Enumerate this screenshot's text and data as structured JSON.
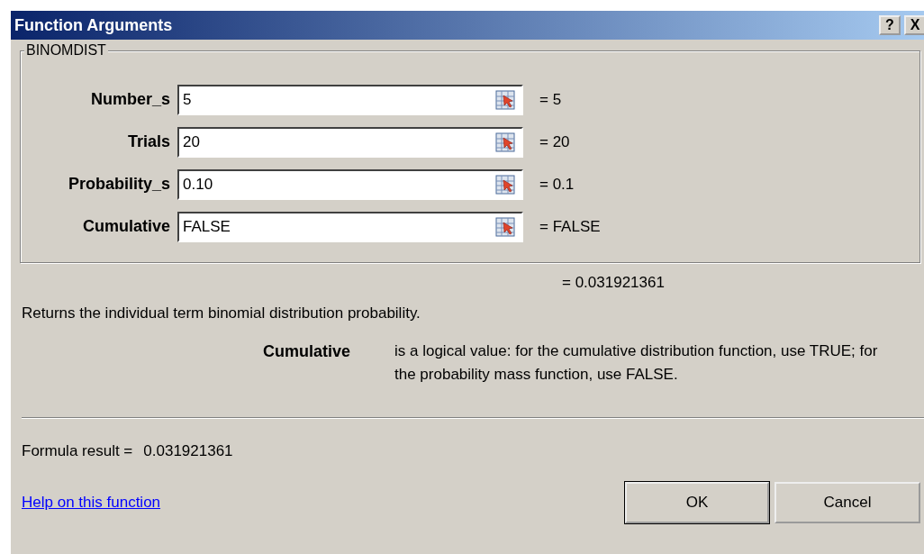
{
  "window": {
    "title": "Function Arguments",
    "title_buttons": [
      {
        "kind": "help",
        "label": "?"
      },
      {
        "kind": "close",
        "label": "X"
      }
    ]
  },
  "group": {
    "title": "BINOMDIST",
    "arguments": [
      {
        "label": "Number_s",
        "value": "5",
        "result": "= 5"
      },
      {
        "label": "Trials",
        "value": "20",
        "result": "= 20"
      },
      {
        "label": "Probability_s",
        "value": "0.10",
        "result": "= 0.1"
      },
      {
        "label": "Cumulative",
        "value": "FALSE",
        "result": "= FALSE"
      }
    ]
  },
  "result": "= 0.031921361",
  "description": "Returns the individual term binomial distribution probability.",
  "argument_help": {
    "name": "Cumulative",
    "text": "is a logical value: for the cumulative distribution function, use TRUE; for the probability mass function, use FALSE."
  },
  "formula_result": {
    "label": "Formula result =",
    "value": "0.031921361"
  },
  "help_link": "Help on this function",
  "buttons": [
    {
      "label": "OK",
      "kind": "default"
    },
    {
      "label": "Cancel",
      "kind": "normal"
    }
  ]
}
